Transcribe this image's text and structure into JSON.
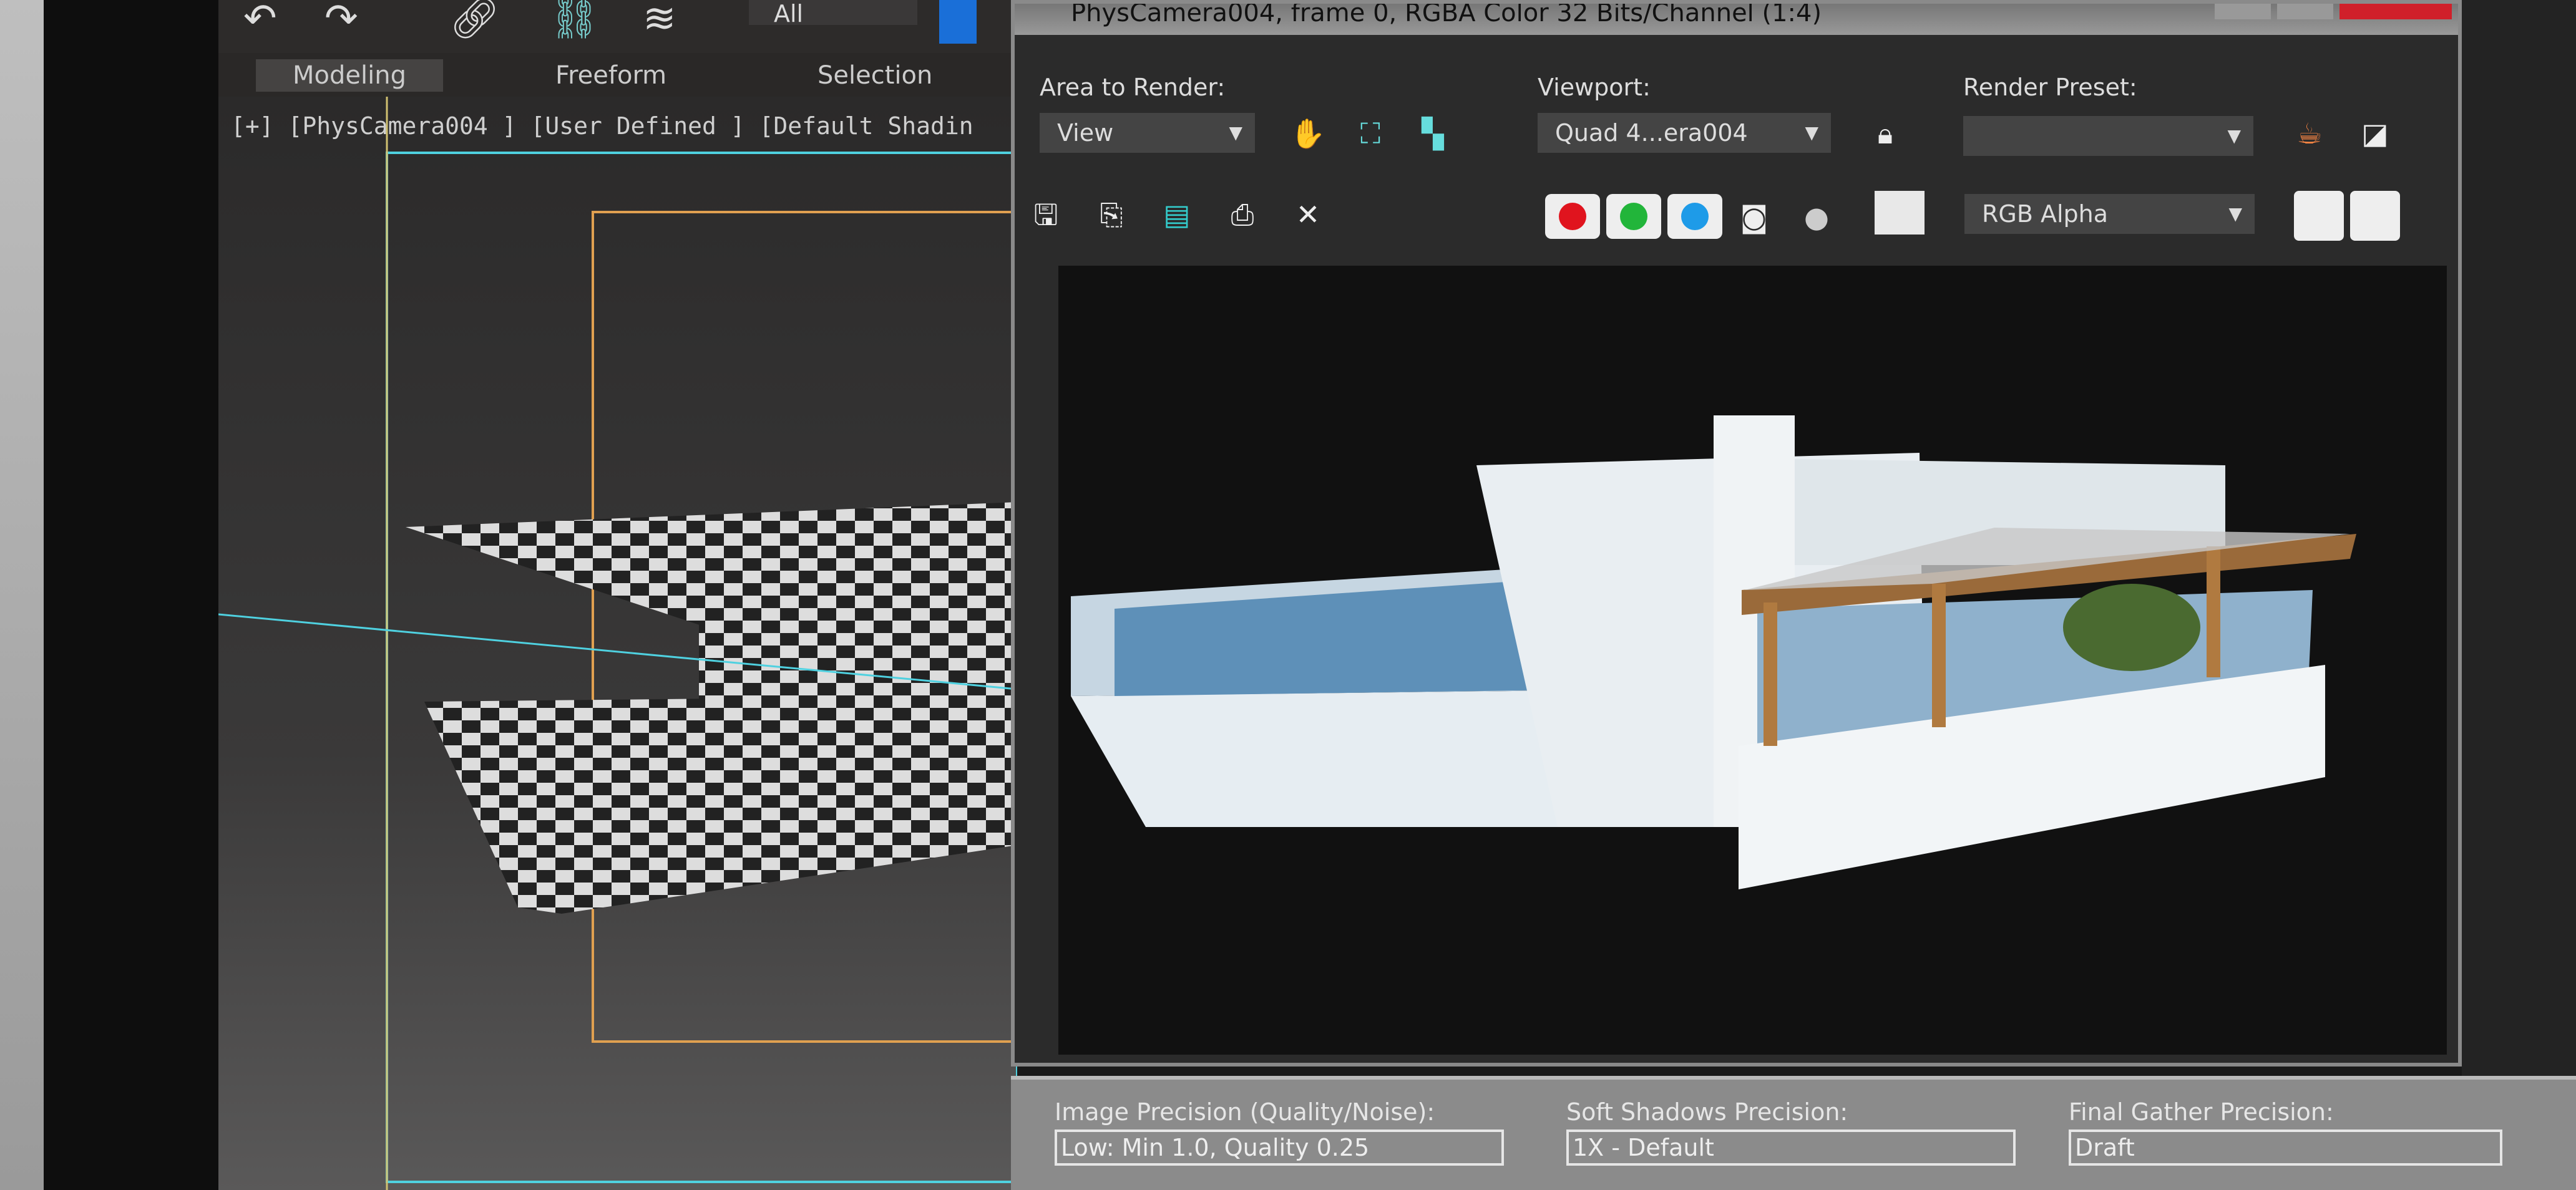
{
  "toolbar": {
    "icons": [
      "undo-icon",
      "redo-icon",
      "link-icon",
      "unlink-icon",
      "bind-space-warp-icon"
    ],
    "selection_filter": "All"
  },
  "ribbon_tabs": [
    {
      "label": "Modeling",
      "active": true
    },
    {
      "label": "Freeform",
      "active": false
    },
    {
      "label": "Selection",
      "active": false
    }
  ],
  "viewport": {
    "label": "[+] [PhysCamera004 ] [User Defined ] [Default Shadin"
  },
  "render_window": {
    "title": "PhysCamera004, frame 0, RGBA Color 32 Bits/Channel (1:4)",
    "area_to_render": {
      "label": "Area to Render:",
      "value": "View"
    },
    "viewport": {
      "label": "Viewport:",
      "value": "Quad 4...era004"
    },
    "render_preset": {
      "label": "Render Preset:",
      "value": ""
    },
    "channel_display": "RGB Alpha",
    "channel_colors": {
      "red": "#e0141e",
      "green": "#22b53a",
      "blue": "#1e9be8"
    }
  },
  "bottom_panel": {
    "image_precision": {
      "label": "Image Precision (Quality/Noise):",
      "value": "Low: Min 1.0, Quality 0.25"
    },
    "soft_shadows": {
      "label": "Soft Shadows Precision:",
      "value": "1X - Default"
    },
    "final_gather": {
      "label": "Final Gather Precision:",
      "value": "Draft"
    }
  }
}
